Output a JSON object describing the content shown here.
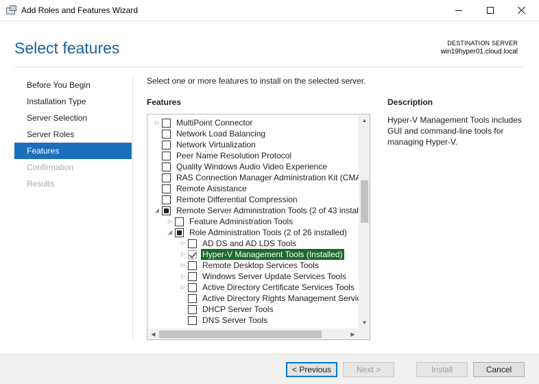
{
  "window": {
    "title": "Add Roles and Features Wizard"
  },
  "header": {
    "page_title": "Select features",
    "destination_label": "DESTINATION SERVER",
    "destination_value": "win19hyper01.cloud.local"
  },
  "nav": {
    "items": [
      {
        "label": "Before You Begin",
        "state": "normal"
      },
      {
        "label": "Installation Type",
        "state": "normal"
      },
      {
        "label": "Server Selection",
        "state": "normal"
      },
      {
        "label": "Server Roles",
        "state": "normal"
      },
      {
        "label": "Features",
        "state": "active"
      },
      {
        "label": "Confirmation",
        "state": "disabled"
      },
      {
        "label": "Results",
        "state": "disabled"
      }
    ]
  },
  "main": {
    "intro": "Select one or more features to install on the selected server.",
    "features_heading": "Features",
    "description_heading": "Description",
    "description_text": "Hyper-V Management Tools includes GUI and command-line tools for managing Hyper-V."
  },
  "features": [
    {
      "label": "MultiPoint Connector",
      "level": 0,
      "expander": "collapsed",
      "checkbox": "unchecked"
    },
    {
      "label": "Network Load Balancing",
      "level": 0,
      "expander": "none",
      "checkbox": "unchecked"
    },
    {
      "label": "Network Virtualization",
      "level": 0,
      "expander": "none",
      "checkbox": "unchecked"
    },
    {
      "label": "Peer Name Resolution Protocol",
      "level": 0,
      "expander": "none",
      "checkbox": "unchecked"
    },
    {
      "label": "Quality Windows Audio Video Experience",
      "level": 0,
      "expander": "none",
      "checkbox": "unchecked"
    },
    {
      "label": "RAS Connection Manager Administration Kit (CMA",
      "level": 0,
      "expander": "none",
      "checkbox": "unchecked"
    },
    {
      "label": "Remote Assistance",
      "level": 0,
      "expander": "none",
      "checkbox": "unchecked"
    },
    {
      "label": "Remote Differential Compression",
      "level": 0,
      "expander": "none",
      "checkbox": "unchecked"
    },
    {
      "label": "Remote Server Administration Tools (2 of 43 instal",
      "level": 0,
      "expander": "expanded",
      "checkbox": "partial"
    },
    {
      "label": "Feature Administration Tools",
      "level": 1,
      "expander": "collapsed",
      "checkbox": "unchecked"
    },
    {
      "label": "Role Administration Tools (2 of 26 installed)",
      "level": 1,
      "expander": "expanded",
      "checkbox": "partial"
    },
    {
      "label": "AD DS and AD LDS Tools",
      "level": 2,
      "expander": "collapsed",
      "checkbox": "unchecked"
    },
    {
      "label": "Hyper-V Management Tools (Installed)",
      "level": 2,
      "expander": "collapsed",
      "checkbox": "checked",
      "selected": true
    },
    {
      "label": "Remote Desktop Services Tools",
      "level": 2,
      "expander": "collapsed",
      "checkbox": "unchecked"
    },
    {
      "label": "Windows Server Update Services Tools",
      "level": 2,
      "expander": "collapsed",
      "checkbox": "unchecked"
    },
    {
      "label": "Active Directory Certificate Services Tools",
      "level": 2,
      "expander": "collapsed",
      "checkbox": "unchecked"
    },
    {
      "label": "Active Directory Rights Management Servic",
      "level": 2,
      "expander": "none",
      "checkbox": "unchecked"
    },
    {
      "label": "DHCP Server Tools",
      "level": 2,
      "expander": "none",
      "checkbox": "unchecked"
    },
    {
      "label": "DNS Server Tools",
      "level": 2,
      "expander": "none",
      "checkbox": "unchecked"
    }
  ],
  "footer": {
    "previous_label": "< Previous",
    "next_label": "Next >",
    "install_label": "Install",
    "cancel_label": "Cancel"
  },
  "colors": {
    "accent": "#1c6fbd",
    "title_blue": "#1f5f97",
    "selection_green": "#1a6b2a",
    "highlight_yellow": "#f5f04a"
  }
}
